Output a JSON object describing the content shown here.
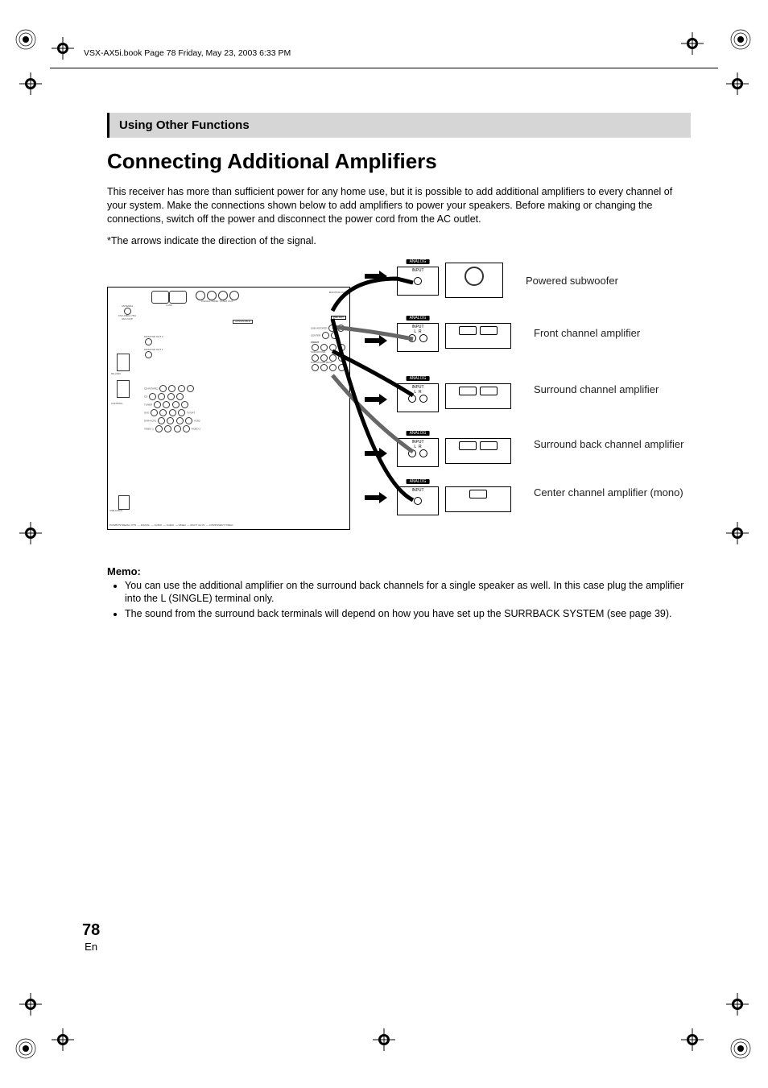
{
  "header": {
    "doc_info": "VSX-AX5i.book  Page 78  Friday, May 23, 2003  6:33 PM"
  },
  "section": {
    "bar_title": "Using Other Functions",
    "h1": "Connecting Additional Amplifiers",
    "intro": "This receiver has more than sufficient power for any home use, but it is possible to add additional amplifiers to every channel of your system. Make the connections shown below to add amplifiers to power your speakers. Before making or changing the connections, switch off the power and disconnect the power cord from the AC outlet.",
    "arrow_note": "*The arrows indicate the direction of the signal."
  },
  "diagram": {
    "analog_label": "ANALOG",
    "input_label": "INPUT",
    "lr_l": "L",
    "lr_r": "R",
    "labels": {
      "powered_subwoofer": "Powered subwoofer",
      "front": "Front channel amplifier",
      "surround": "Surround channel amplifier",
      "surround_back": "Surround back channel amplifier",
      "center": "Center channel amplifier (mono)"
    },
    "panel_text": {
      "pre_out": "PRE OUT",
      "sub_woofer": "SUB WOOFER",
      "center": "CENTER",
      "front": "FRONT",
      "sur_round": "SUR-ROUND",
      "sur_round_back": "SUR-ROUND BACK",
      "monitor_out1": "MONITOR OUT 1",
      "monitor_out2": "MONITOR OUT 2",
      "monitor_out": "MONITOR OUT",
      "assignable": "ASSIGNABLE",
      "antenna": "ANTENNA",
      "control": "CONTROL",
      "am_loop": "AM LOOP",
      "fm_unbal": "FM UNBAL 75Ω",
      "digital": "DIGITAL",
      "audio": "AUDIO",
      "video": "VIDEO",
      "multi_ch_in": "MULTI CH IN",
      "component_video": "COMPONENT VIDEO",
      "dvd_ld_tape1": "DVD/LD TAPE1",
      "tv_sat": "TV/SAT",
      "cd": "CD",
      "cdr_tape2": "CD-R/TAPE2",
      "tuner": "TUNER",
      "video1": "VIDEO 1",
      "video2": "VIDEO 2",
      "dvd": "DVD",
      "dvr_vcr1": "DVR/VCR1",
      "vcr2": "VCR2",
      "usb_audio": "USB AUDIO",
      "ilink": "i.LINK",
      "rs232c": "RS-232C",
      "dts": "DTS",
      "pcm_bitstream": "PCM/BITSTREAM",
      "in": "IN",
      "out": "OUT"
    }
  },
  "memo": {
    "heading": "Memo:",
    "items": [
      "You can use the additional amplifier on the surround back channels for a single speaker as well. In this case plug the amplifier into the L (SINGLE) terminal only.",
      "The sound from the surround back terminals will depend on how you have set up the SURRBACK SYSTEM (see page 39)."
    ]
  },
  "footer": {
    "page": "78",
    "lang": "En"
  }
}
